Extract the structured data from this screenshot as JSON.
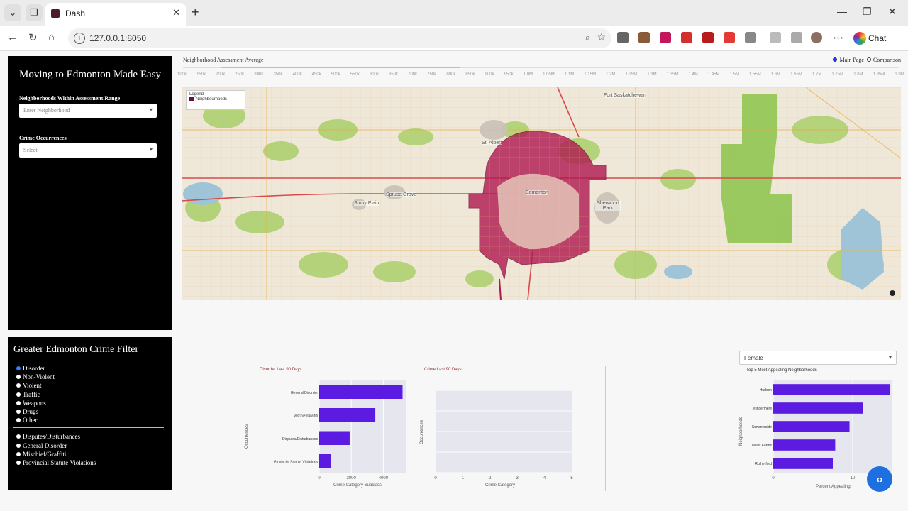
{
  "browser": {
    "tab_title": "Dash",
    "url": "127.0.0.1:8050",
    "chat_label": "Chat"
  },
  "sidebar": {
    "title": "Moving to Edmonton Made Easy",
    "range_label": "Neighborhoods Within Assessment Range",
    "range_placeholder": "Enter Neighborhood",
    "crime_label": "Crime Occurrences",
    "crime_placeholder": "Select"
  },
  "crime_filter": {
    "title": "Greater Edmonton Crime Filter",
    "group1": [
      {
        "label": "Disorder",
        "selected": true
      },
      {
        "label": "Non-Violent",
        "selected": false
      },
      {
        "label": "Violent",
        "selected": false
      },
      {
        "label": "Traffic",
        "selected": false
      },
      {
        "label": "Weapons",
        "selected": false
      },
      {
        "label": "Drugs",
        "selected": false
      },
      {
        "label": "Other",
        "selected": false
      }
    ],
    "group2": [
      {
        "label": "Disputes/Disturbances",
        "selected": false
      },
      {
        "label": "General Disorder",
        "selected": false
      },
      {
        "label": "Mischief/Graffiti",
        "selected": false
      },
      {
        "label": "Provincial Statute Violations",
        "selected": false
      }
    ]
  },
  "assessment": {
    "title": "Neighborhood Assessment Average",
    "ticks": [
      "100k",
      "150k",
      "200k",
      "250k",
      "300k",
      "350k",
      "400k",
      "450k",
      "500k",
      "550k",
      "600k",
      "650k",
      "700k",
      "750k",
      "800k",
      "850k",
      "900k",
      "950k",
      "1.0M",
      "1.05M",
      "1.1M",
      "1.15M",
      "1.2M",
      "1.25M",
      "1.3M",
      "1.35M",
      "1.4M",
      "1.45M",
      "1.5M",
      "1.55M",
      "1.6M",
      "1.65M",
      "1.7M",
      "1.75M",
      "1.8M",
      "1.85M",
      "1.9M"
    ],
    "modes": [
      {
        "label": "Main Page",
        "selected": true
      },
      {
        "label": "Comparison",
        "selected": false
      }
    ]
  },
  "map": {
    "legend_title": "Legend",
    "legend_item": "Neighbourhoods",
    "places": [
      "Fort Saskatchewan",
      "St. Albert",
      "Spruce Grove",
      "Stony Plain",
      "Edmonton",
      "Sherwood Park"
    ]
  },
  "chart_disorder": {
    "title": "Disorder Last 90 Days",
    "ylabel": "Occurrences",
    "xlabel": "Crime Category Subclass"
  },
  "chart_empty": {
    "title": "Crime Last 90 Days",
    "ylabel": "Occurrences",
    "xlabel": "Crime Category"
  },
  "chart_top": {
    "dropdown_value": "Female",
    "title": "Top 5 Most Appealing Neighborhoods",
    "ylabel": "Neighborhoods",
    "xlabel": "Percent Appealing"
  },
  "chart_data": [
    {
      "type": "bar",
      "orientation": "horizontal",
      "title": "Disorder Last 90 Days",
      "categories": [
        "General Disorder",
        "Mischief/Graffiti",
        "Disputes/Disturbances",
        "Provincial Statute Violations"
      ],
      "values": [
        5200,
        3500,
        1900,
        750
      ],
      "xticks": [
        "0",
        "2000",
        "4000"
      ],
      "xlim": [
        0,
        5400
      ]
    },
    {
      "type": "bar",
      "orientation": "vertical",
      "title": "Crime Last 90 Days",
      "categories": [],
      "values": [],
      "xticks": [
        "0",
        "1",
        "2",
        "3",
        "4",
        "5"
      ],
      "ylim": [
        0,
        4
      ]
    },
    {
      "type": "bar",
      "orientation": "horizontal",
      "title": "Top 5 Most Appealing Neighborhoods",
      "categories": [
        "Hudson",
        "Windermere",
        "Summerside",
        "Lewis Farms",
        "Rutherford"
      ],
      "values": [
        14.7,
        11.3,
        9.6,
        7.8,
        7.5
      ],
      "xticks": [
        "0",
        "10"
      ],
      "xlim": [
        0,
        15
      ]
    }
  ]
}
